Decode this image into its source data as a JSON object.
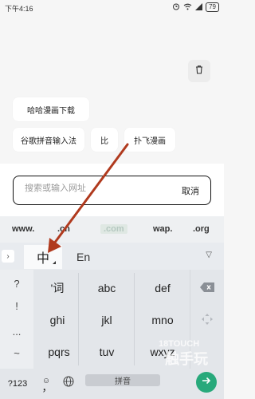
{
  "status_bar": {
    "time": "下午4:16",
    "battery": "79"
  },
  "history_chips": [
    {
      "label": "哈哈漫画下载"
    },
    {
      "label": "谷歌拼音输入法"
    },
    {
      "label": "比"
    },
    {
      "label": "扑飞漫画"
    }
  ],
  "search": {
    "placeholder": "搜索或输入网址",
    "cancel_label": "取消"
  },
  "suggestions": [
    "www.",
    ".cn",
    ".com",
    "wap.",
    ".org"
  ],
  "keyboard": {
    "tab_chinese": "中",
    "tab_english": "En",
    "side_keys": [
      "?",
      "!",
      "...",
      "~"
    ],
    "rows": [
      [
        "'词",
        "abc",
        "def"
      ],
      [
        "ghi",
        "jkl",
        "mno"
      ],
      [
        "pqrs",
        "tuv",
        "wxyz"
      ]
    ],
    "symbol_key": "?123",
    "comma_key": "，",
    "space_label": "拼音"
  },
  "colors": {
    "enter_key": "#28a97b",
    "arrow": "#b03a1e"
  },
  "watermark": "18TOUCH 触手玩"
}
